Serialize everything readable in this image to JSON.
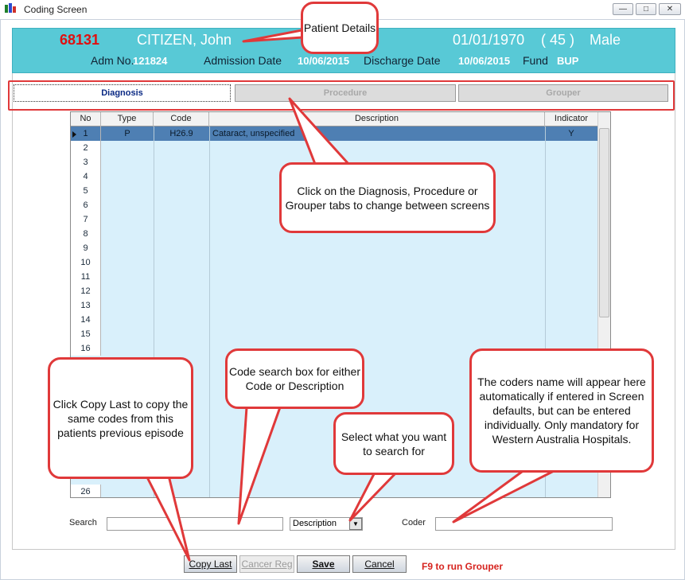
{
  "window": {
    "title": "Coding Screen",
    "min_glyph": "—",
    "max_glyph": "□",
    "close_glyph": "✕"
  },
  "patient": {
    "mrn": "68131",
    "name": "CITIZEN,  John",
    "dob": "01/01/1970",
    "age": "( 45 )",
    "sex": "Male",
    "adm_no_label": "Adm No.",
    "adm_no": "121824",
    "admission_date_label": "Admission Date",
    "admission_date": "10/06/2015",
    "discharge_date_label": "Discharge Date",
    "discharge_date": "10/06/2015",
    "fund_label": "Fund",
    "fund": "BUP"
  },
  "tabs": [
    {
      "label": "Diagnosis",
      "active": true
    },
    {
      "label": "Procedure",
      "active": false
    },
    {
      "label": "Grouper",
      "active": false
    }
  ],
  "grid": {
    "columns": [
      "No",
      "Type",
      "Code",
      "Description",
      "Indicator"
    ],
    "rows": [
      {
        "no": "1",
        "type": "P",
        "code": "H26.9",
        "description": "Cataract, unspecified",
        "indicator": "Y",
        "selected": true
      },
      {
        "no": "2"
      },
      {
        "no": "3"
      },
      {
        "no": "4"
      },
      {
        "no": "5"
      },
      {
        "no": "6"
      },
      {
        "no": "7"
      },
      {
        "no": "8"
      },
      {
        "no": "9"
      },
      {
        "no": "10"
      },
      {
        "no": "11"
      },
      {
        "no": "12"
      },
      {
        "no": "13"
      },
      {
        "no": "14"
      },
      {
        "no": "15"
      },
      {
        "no": "16"
      },
      {
        "no": "26"
      }
    ]
  },
  "search": {
    "label": "Search",
    "value": "",
    "type_value": "Description",
    "dropdown_glyph": "▼"
  },
  "coder": {
    "label": "Coder",
    "value": ""
  },
  "buttons": {
    "copy_last": "Copy Last",
    "cancer_reg": "Cancer Reg",
    "save": "Save",
    "cancel": "Cancel"
  },
  "f9_hint": "F9 to run Grouper",
  "callouts": {
    "patient": "Patient Details",
    "tabs": "Click on the Diagnosis, Procedure or Grouper tabs to change between screens",
    "copy": "Click Copy Last to copy the same codes from this patients previous episode",
    "search": "Code search box for either Code or Description",
    "select": "Select what you want to search for",
    "coder": "The coders name will appear here automatically if entered in Screen defaults, but can be entered individually. Only mandatory for Western Australia Hospitals."
  },
  "colors": {
    "header_bg": "#58c9d6",
    "accent_red": "#e0393a",
    "selected_row": "#4e7fb3",
    "grid_bg": "#d9f0fb"
  }
}
